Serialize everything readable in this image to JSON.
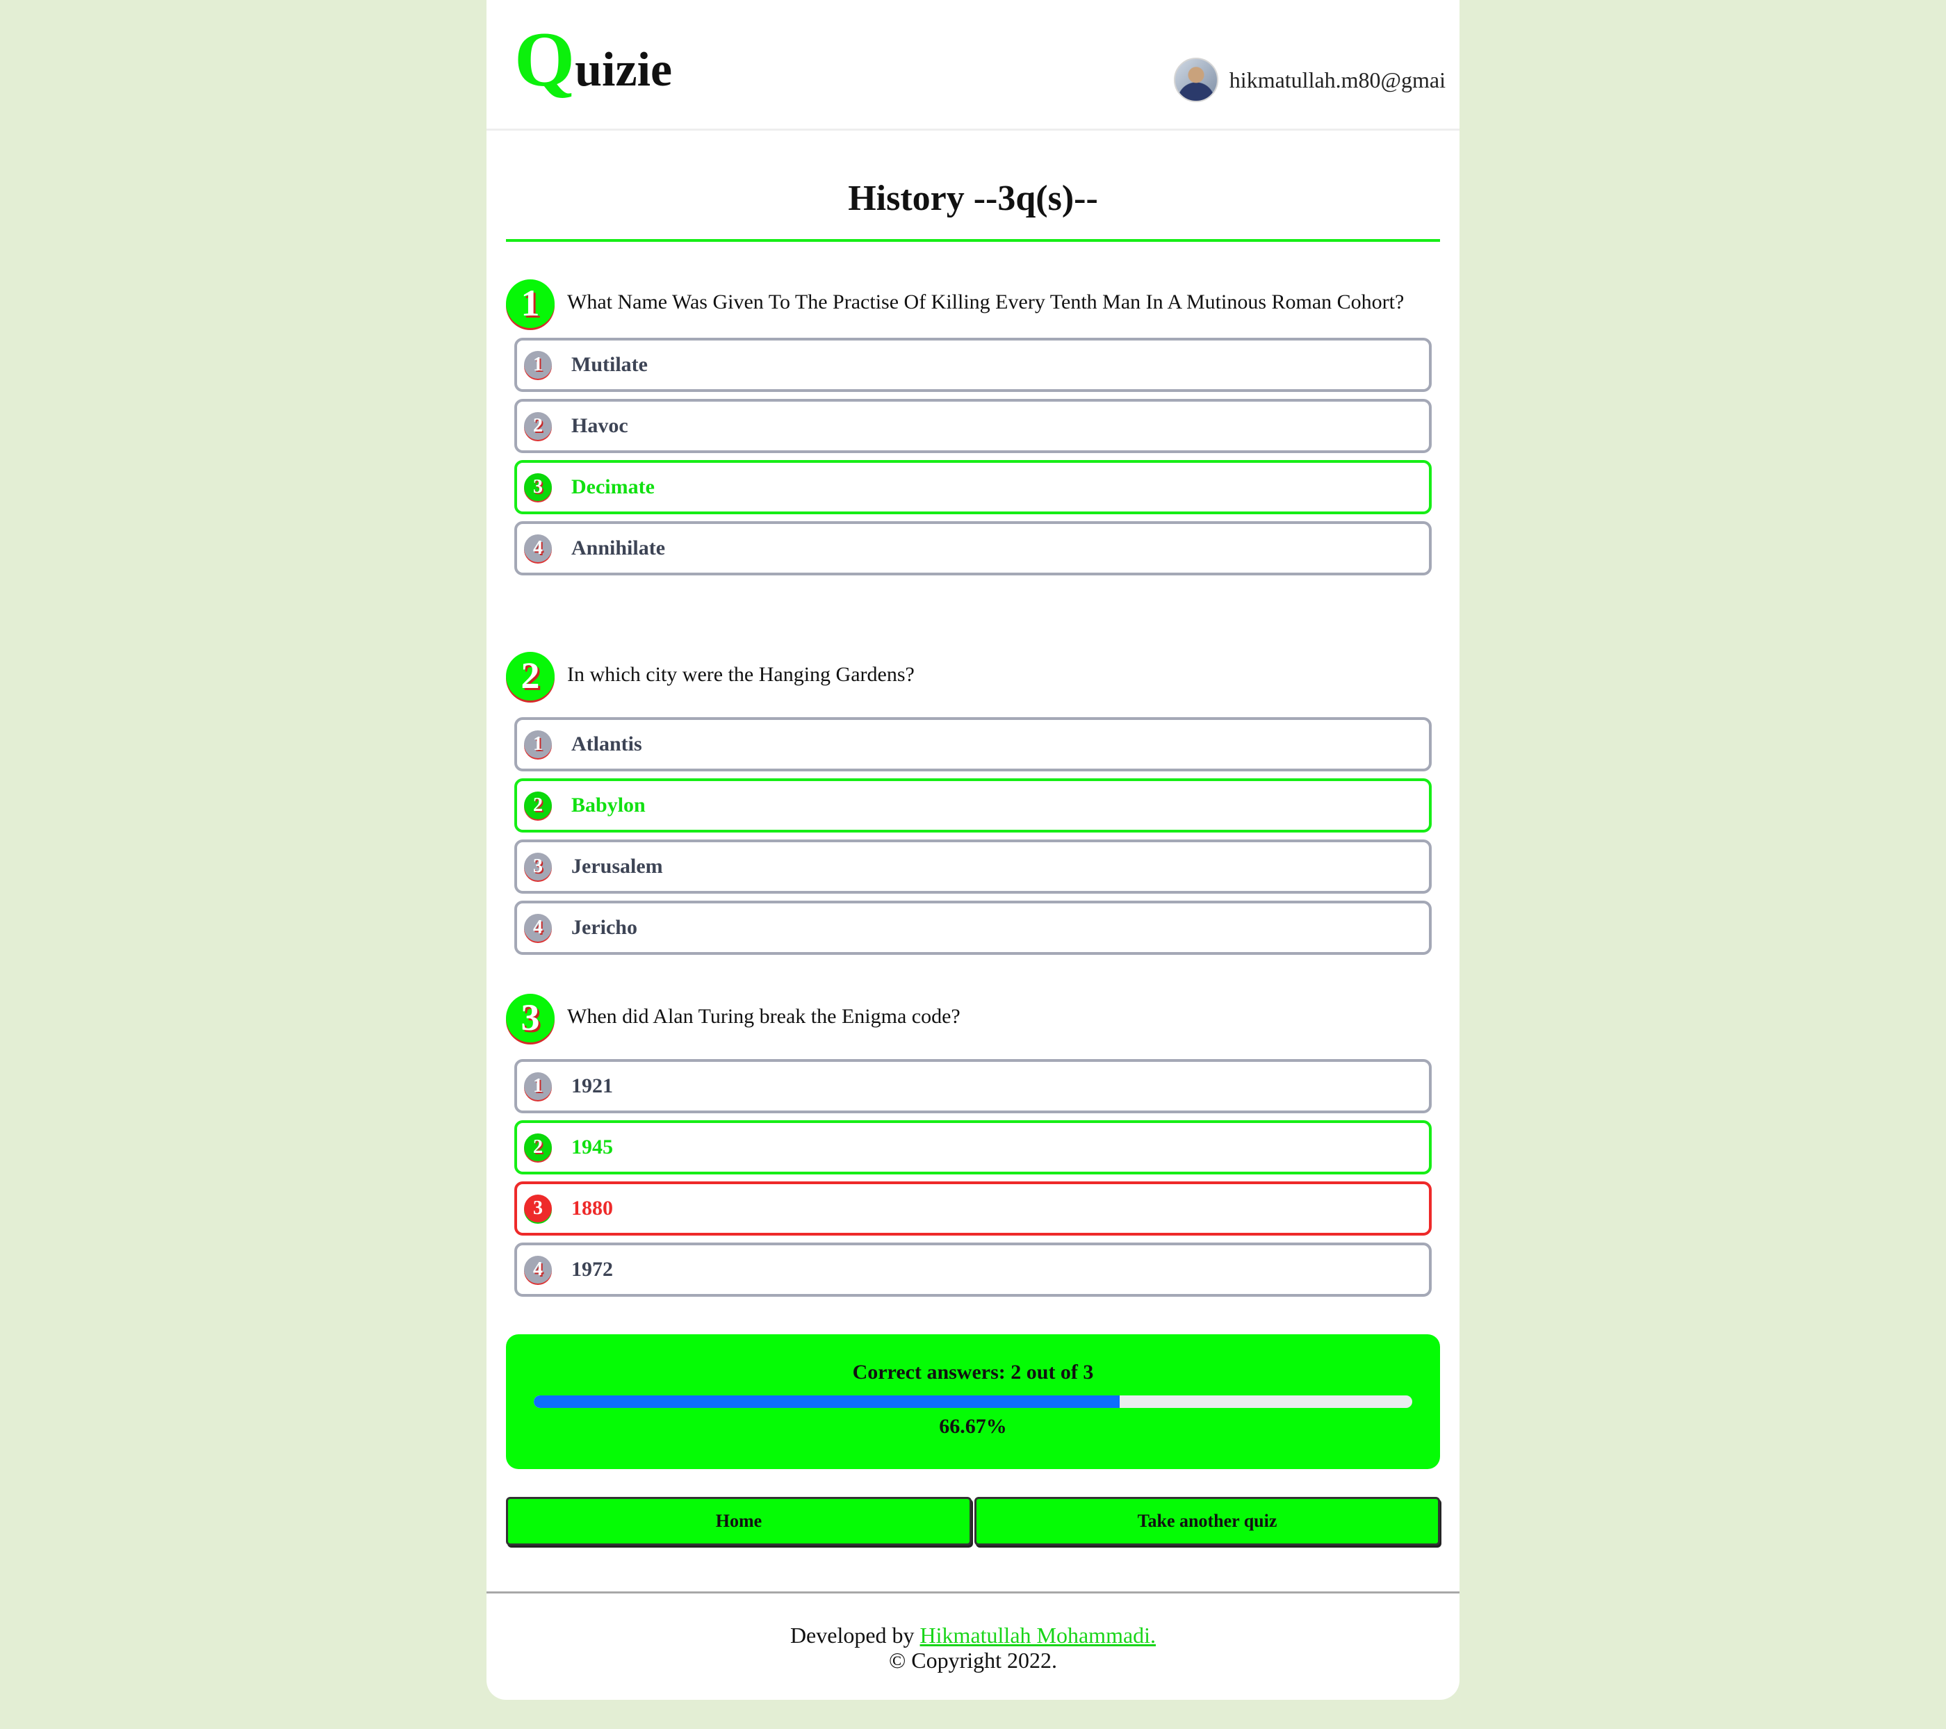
{
  "header": {
    "logo_initial": "Q",
    "logo_rest": "uizie",
    "user_email": "hikmatullah.m80@gmai"
  },
  "page_title": "History --3q(s)--",
  "questions": [
    {
      "number": "1",
      "text": "What Name Was Given To The Practise Of Killing Every Tenth Man In A Mutinous Roman Cohort?",
      "options": [
        {
          "num": "1",
          "label": "Mutilate",
          "state": "normal"
        },
        {
          "num": "2",
          "label": "Havoc",
          "state": "normal"
        },
        {
          "num": "3",
          "label": "Decimate",
          "state": "correct"
        },
        {
          "num": "4",
          "label": "Annihilate",
          "state": "normal"
        }
      ]
    },
    {
      "number": "2",
      "text": "In which city were the Hanging Gardens?",
      "options": [
        {
          "num": "1",
          "label": "Atlantis",
          "state": "normal"
        },
        {
          "num": "2",
          "label": "Babylon",
          "state": "correct"
        },
        {
          "num": "3",
          "label": "Jerusalem",
          "state": "normal"
        },
        {
          "num": "4",
          "label": "Jericho",
          "state": "normal"
        }
      ]
    },
    {
      "number": "3",
      "text": "When did Alan Turing break the Enigma code?",
      "options": [
        {
          "num": "1",
          "label": "1921",
          "state": "normal"
        },
        {
          "num": "2",
          "label": "1945",
          "state": "correct"
        },
        {
          "num": "3",
          "label": "1880",
          "state": "wrong"
        },
        {
          "num": "4",
          "label": "1972",
          "state": "normal"
        }
      ]
    }
  ],
  "score": {
    "label": "Correct answers: 2 out of 3",
    "percent_text": "66.67%",
    "progress": 0.6667
  },
  "buttons": {
    "home": "Home",
    "another": "Take another quiz"
  },
  "footer": {
    "developed_by": "Developed by ",
    "author": "Hikmatullah Mohammadi.",
    "copyright": "© Copyright 2022."
  },
  "colors": {
    "page_bg": "#e3eed4",
    "accent_green": "#05fc05",
    "wrong_red": "#ee2a2a",
    "progress_blue": "#0d6efd"
  }
}
